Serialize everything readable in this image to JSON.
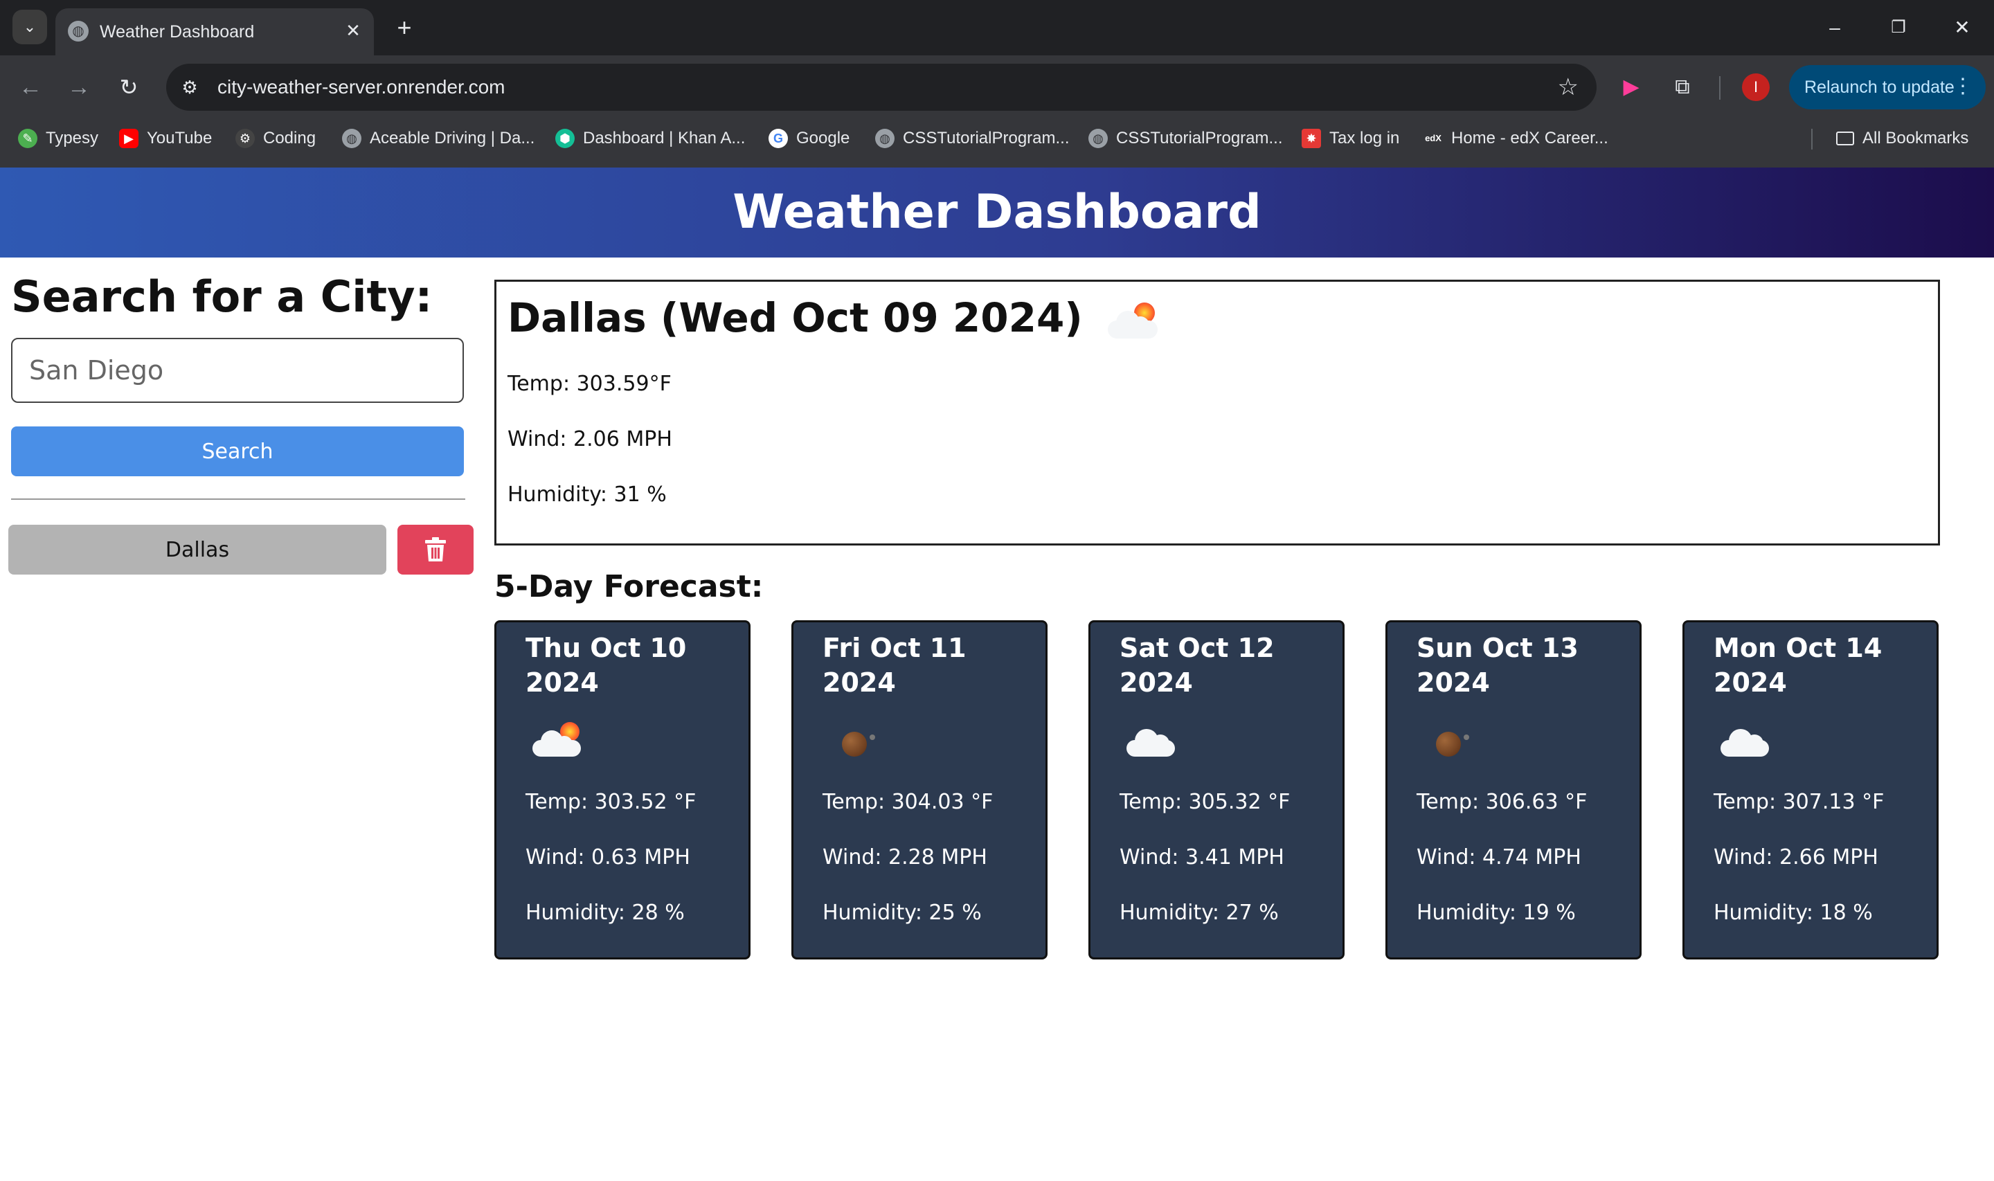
{
  "browser": {
    "tab_title": "Weather Dashboard",
    "url": "city-weather-server.onrender.com",
    "relaunch_label": "Relaunch to update",
    "profile_initial": "I",
    "bookmarks": [
      {
        "label": "Typesy",
        "icon": "typesy-icon",
        "color": "#4caf50"
      },
      {
        "label": "YouTube",
        "icon": "youtube-icon",
        "color": "#ff0000"
      },
      {
        "label": "Coding",
        "icon": "coding-icon",
        "color": "#444444"
      },
      {
        "label": "Aceable Driving | Da...",
        "icon": "globe-icon",
        "color": "#9aa0a6"
      },
      {
        "label": "Dashboard | Khan A...",
        "icon": "khan-academy-icon",
        "color": "#14bf96"
      },
      {
        "label": "Google",
        "icon": "google-icon",
        "color": "#ffffff"
      },
      {
        "label": "CSSTutorialProgram...",
        "icon": "globe-icon",
        "color": "#9aa0a6"
      },
      {
        "label": "CSSTutorialProgram...",
        "icon": "globe-icon",
        "color": "#9aa0a6"
      },
      {
        "label": "Tax log in",
        "icon": "tax-icon",
        "color": "#e53935"
      },
      {
        "label": "Home - edX Career...",
        "icon": "edx-icon",
        "color": "#35363a"
      }
    ],
    "all_bookmarks": "All Bookmarks"
  },
  "header": {
    "title": "Weather Dashboard"
  },
  "sidebar": {
    "title": "Search for a City:",
    "search_value": "",
    "search_placeholder": "San Diego",
    "search_button": "Search",
    "history": [
      "Dallas"
    ]
  },
  "today": {
    "title": "Dallas (Wed Oct 09 2024)",
    "icon": "sun-behind-cloud-icon",
    "temp": "Temp: 303.59°F",
    "wind": "Wind: 2.06 MPH",
    "humidity": "Humidity: 31 %"
  },
  "forecast": {
    "title": "5-Day Forecast:",
    "days": [
      {
        "date": "Thu Oct 10 2024",
        "icon": "sun-behind-cloud-icon",
        "temp": "Temp: 303.52 °F",
        "wind": "Wind: 0.63 MPH",
        "humidity": "Humidity: 28 %"
      },
      {
        "date": "Fri Oct 11 2024",
        "icon": "moon-icon",
        "temp": "Temp: 304.03 °F",
        "wind": "Wind: 2.28 MPH",
        "humidity": "Humidity: 25 %"
      },
      {
        "date": "Sat Oct 12 2024",
        "icon": "cloud-icon",
        "temp": "Temp: 305.32 °F",
        "wind": "Wind: 3.41 MPH",
        "humidity": "Humidity: 27 %"
      },
      {
        "date": "Sun Oct 13 2024",
        "icon": "moon-icon",
        "temp": "Temp: 306.63 °F",
        "wind": "Wind: 4.74 MPH",
        "humidity": "Humidity: 19 %"
      },
      {
        "date": "Mon Oct 14 2024",
        "icon": "cloud-icon",
        "temp": "Temp: 307.13 °F",
        "wind": "Wind: 2.66 MPH",
        "humidity": "Humidity: 18 %"
      }
    ]
  },
  "colors": {
    "search_button": "#4a8fe7",
    "delete_button": "#e2435b",
    "history_button": "#b3b3b3",
    "forecast_card": "#2c3a50"
  }
}
